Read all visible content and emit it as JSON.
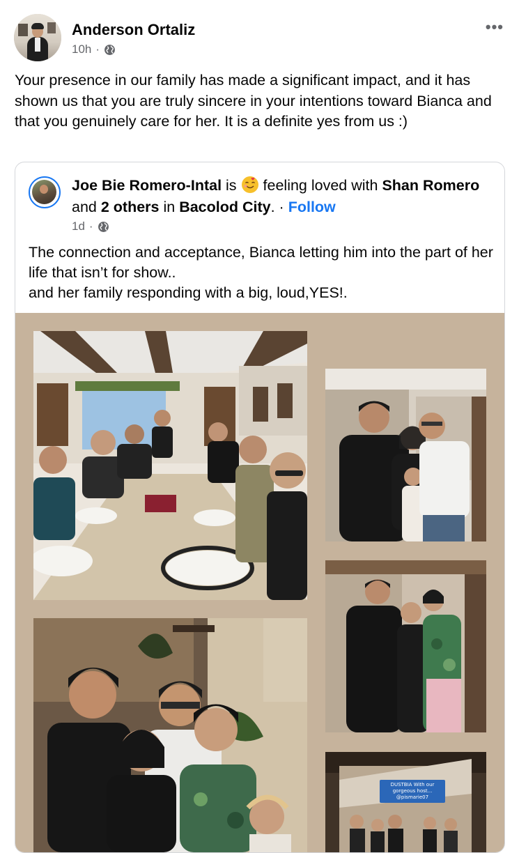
{
  "post": {
    "author": "Anderson Ortaliz",
    "time": "10h",
    "separator": "·",
    "more_label": "•••",
    "text": "Your presence in our family has made a significant impact, and it has shown us that you are truly sincere in your intentions toward Bianca and that you genuinely care for her. It is a definite yes from us :)"
  },
  "shared": {
    "author": "Joe Bie Romero-Intal",
    "is_word": "is",
    "feeling": "feeling loved with",
    "tagged_name": "Shan Romero",
    "and_word": "and",
    "others": "2 others",
    "in_word": "in",
    "location": "Bacolod City",
    "dot": ". ·",
    "follow_label": "Follow",
    "time": "1d",
    "separator": "·",
    "text_line1": "The connection and acceptance, Bianca letting him into the part of her life that isn’t for show..",
    "text_line2": "and her family responding with a big, loud,YES!.",
    "story_caption": "DUSTBIA With our gorgeous host... @pismarie07"
  },
  "colors": {
    "link": "#1877f2",
    "secondary_text": "#65676b",
    "collage_bg": "#c6b39c"
  },
  "icons": [
    "globe-icon",
    "more-options-icon",
    "feeling-loved-emoji"
  ]
}
